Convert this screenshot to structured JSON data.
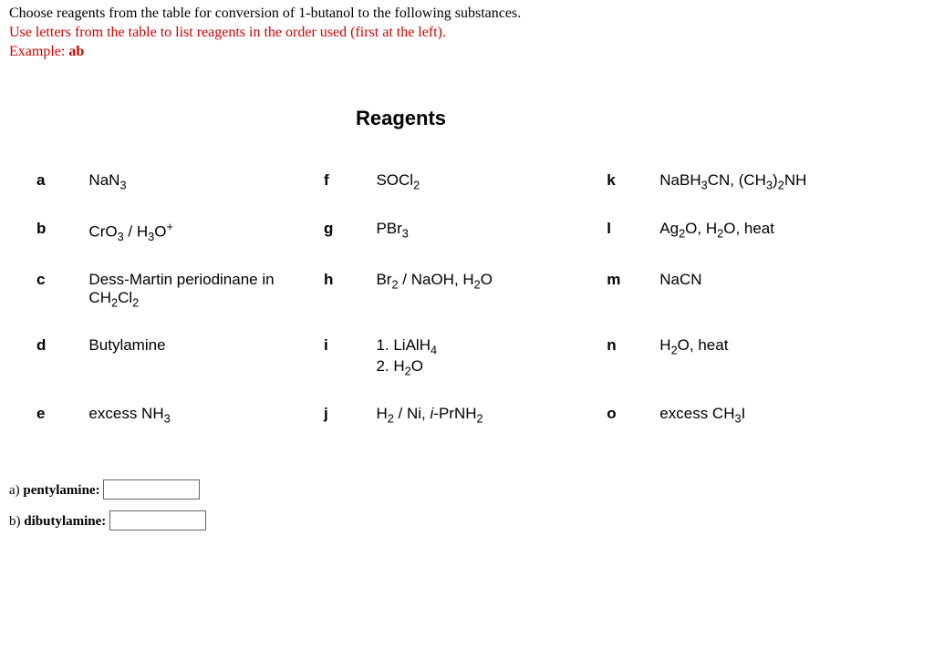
{
  "instructions": {
    "line1": "Choose reagents from the table for conversion of 1-butanol to the following substances.",
    "line2": "Use letters from the table to list reagents in the order used (first at the left).",
    "line3_prefix": "Example: ",
    "line3_bold": "ab"
  },
  "reagents_title": "Reagents",
  "reagents": {
    "a": {
      "key": "a",
      "html": "NaN<sub>3</sub>"
    },
    "b": {
      "key": "b",
      "html": "CrO<sub>3</sub> / H<sub>3</sub>O<sup>+</sup>"
    },
    "c": {
      "key": "c",
      "html": "Dess-Martin periodinane in CH<sub>2</sub>Cl<sub>2</sub>"
    },
    "d": {
      "key": "d",
      "html": "Butylamine"
    },
    "e": {
      "key": "e",
      "html": "excess NH<sub>3</sub>"
    },
    "f": {
      "key": "f",
      "html": "SOCl<sub>2</sub>"
    },
    "g": {
      "key": "g",
      "html": "PBr<sub>3</sub>"
    },
    "h": {
      "key": "h",
      "html": "Br<sub>2</sub> / NaOH, H<sub>2</sub>O"
    },
    "i": {
      "key": "i",
      "html": "1. LiAlH<sub>4</sub><br>2. H<sub>2</sub>O"
    },
    "j": {
      "key": "j",
      "html": "H<sub>2</sub> / Ni, <span class=\"i-style\">i</span>-PrNH<sub>2</sub>"
    },
    "k": {
      "key": "k",
      "html": "NaBH<sub>3</sub>CN, (CH<sub>3</sub>)<sub>2</sub>NH"
    },
    "l": {
      "key": "l",
      "html": "Ag<sub>2</sub>O, H<sub>2</sub>O, heat"
    },
    "m": {
      "key": "m",
      "html": "NaCN"
    },
    "n": {
      "key": "n",
      "html": "H<sub>2</sub>O, heat"
    },
    "o": {
      "key": "o",
      "html": "excess CH<sub>3</sub>I"
    }
  },
  "questions": {
    "a": {
      "label_prefix": "a) ",
      "label_bold": "pentylamine:",
      "value": ""
    },
    "b": {
      "label_prefix": "b) ",
      "label_bold": "dibutylamine:",
      "value": ""
    }
  }
}
